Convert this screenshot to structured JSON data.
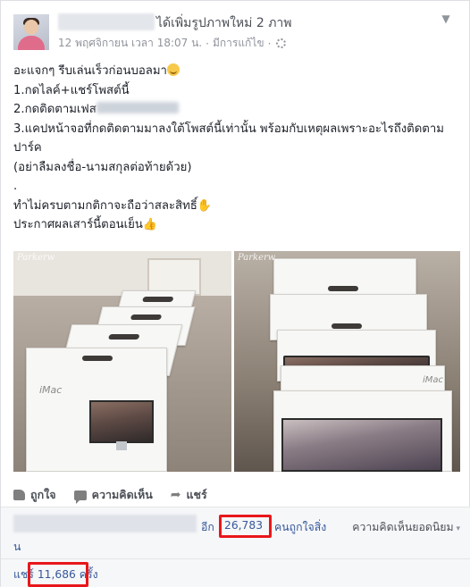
{
  "post": {
    "title_suffix": "ได้เพิ่มรูปภาพใหม่ 2 ภาพ",
    "date": "12 พฤศจิกายน เวลา 18:07 น.",
    "separator": "·",
    "edited": "มีการแก้ไข",
    "lines": [
      "อะแจกๆ รีบเล่นเร็วก่อนบอลมา",
      "1.กดไลค์+แชร์โพสต์นี้",
      "2.กดติดตามเฟส",
      "3.แคปหน้าจอที่กดติดตามมาลงใต้โพสต์นี้เท่านั้น พร้อมกับเหตุผลเพราะอะไรถึงติดตามปาร์ค",
      "(อย่าลืมลงชื่อ-นามสกุลต่อท้ายด้วย)",
      ".",
      "ทำไม่ครบตามกติกาจะถือว่าสละสิทธิ์",
      "ประกาศผลเสาร์นี้ตอนเย็น"
    ],
    "watermark": "Parkerw",
    "box_brand": "iMac"
  },
  "actions": {
    "like": "ถูกใจ",
    "comment": "ความคิดเห็น",
    "share": "แชร์"
  },
  "stats": {
    "and_others_prefix": "อีก",
    "like_count": "26,783",
    "like_suffix": "คนถูกใจสิ่ง",
    "like_suffix_wrap": "น",
    "top_comments": "ความคิดเห็นยอดนิยม",
    "share_prefix": "แชร์",
    "share_count": "11,686",
    "share_suffix": "ครั้ง"
  },
  "colors": {
    "link": "#365899",
    "highlight": "#e8171b",
    "muted": "#90949c"
  }
}
